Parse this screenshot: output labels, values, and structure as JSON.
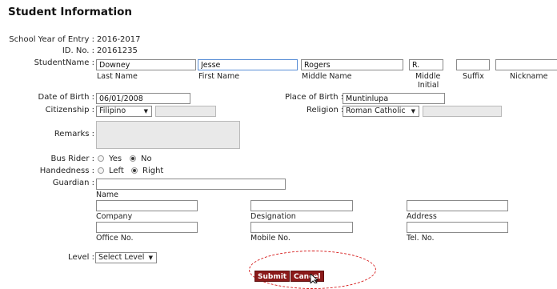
{
  "title": "Student Information",
  "labels": {
    "school_year": "School Year of Entry :",
    "id_no": "ID. No. :",
    "student_name": "StudentName :",
    "dob": "Date of Birth :",
    "citizenship": "Citizenship :",
    "remarks": "Remarks :",
    "bus_rider": "Bus Rider :",
    "handedness": "Handedness :",
    "guardian": "Guardian :",
    "level": "Level :",
    "place_of_birth": "Place of Birth :",
    "religion": "Religion :"
  },
  "values": {
    "school_year": "2016-2017",
    "id_no": "20161235",
    "last_name": "Downey",
    "first_name": "Jesse",
    "middle_name": "Rogers",
    "middle_initial": "R.",
    "suffix": "",
    "nickname": "",
    "dob": "06/01/2008",
    "place_of_birth": "Muntinlupa",
    "citizenship": "Filipino",
    "religion": "Roman Catholic",
    "level": "Select Level"
  },
  "sublabels": {
    "last_name": "Last Name",
    "first_name": "First Name",
    "middle_name": "Middle Name",
    "middle_initial_1": "Middle",
    "middle_initial_2": "Initial",
    "suffix": "Suffix",
    "nickname": "Nickname",
    "name": "Name",
    "company": "Company",
    "designation": "Designation",
    "address": "Address",
    "office_no": "Office No.",
    "mobile_no": "Mobile No.",
    "tel_no": "Tel. No."
  },
  "radio": {
    "bus_rider": {
      "yes": "Yes",
      "no": "No",
      "selected": "No"
    },
    "handedness": {
      "left": "Left",
      "right": "Right",
      "selected": "Right"
    }
  },
  "buttons": {
    "submit": "Submit",
    "cancel": "Cancel"
  },
  "annotation_color": "#d61c1c",
  "button_color": "#8b1a1a"
}
